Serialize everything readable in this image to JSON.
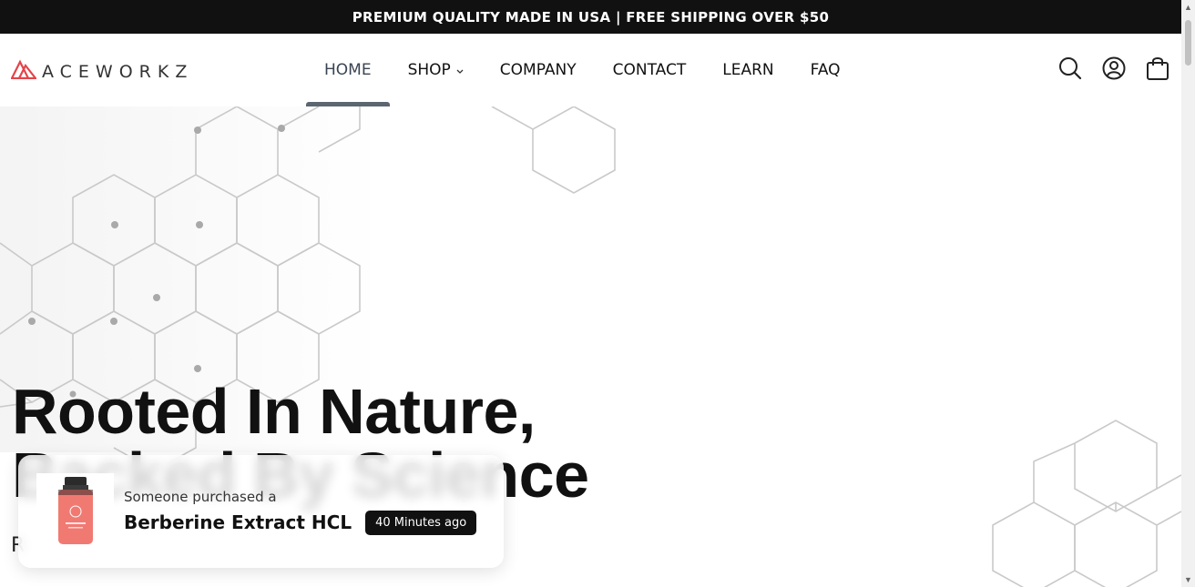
{
  "announcement": "PREMIUM QUALITY MADE IN USA | FREE SHIPPING OVER $50",
  "header": {
    "logo_text": "ACEWORKZ",
    "nav": [
      {
        "label": "HOME",
        "active": true
      },
      {
        "label": "SHOP",
        "has_dropdown": true
      },
      {
        "label": "COMPANY"
      },
      {
        "label": "CONTACT"
      },
      {
        "label": "LEARN"
      },
      {
        "label": "FAQ"
      }
    ],
    "icons": [
      "search-icon",
      "account-icon",
      "cart-icon"
    ]
  },
  "hero": {
    "title_line1": "Rooted In Nature,",
    "title_line2": "Backed By Science",
    "subtitle_visible": "R"
  },
  "toast": {
    "prefix": "Someone purchased a",
    "product": "Berberine Extract HCL",
    "time": "40 Minutes ago"
  },
  "colors": {
    "announcement_bg": "#111111",
    "accent_red": "#e4444a",
    "nav_active_bar": "#5c6671",
    "bottle": "#f07a72"
  }
}
